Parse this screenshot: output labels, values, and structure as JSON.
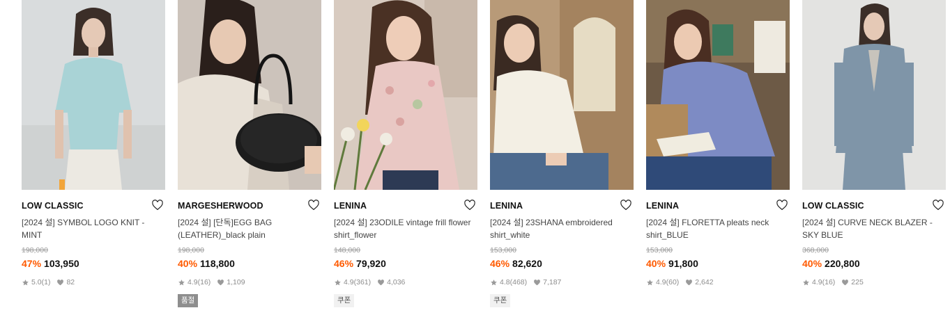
{
  "products": [
    {
      "brand": "LOW CLASSIC",
      "title": "[2024 설] SYMBOL LOGO KNIT - MINT",
      "original_price": "198,000",
      "discount": "47%",
      "price": "103,950",
      "rating": "5.0",
      "reviews": "(1)",
      "likes": "82",
      "tag": ""
    },
    {
      "brand": "MARGESHERWOOD",
      "title": "[2024 설] [단독]EGG BAG (LEATHER)_black plain",
      "original_price": "198,000",
      "discount": "40%",
      "price": "118,800",
      "rating": "4.9",
      "reviews": "(16)",
      "likes": "1,109",
      "tag": "품절"
    },
    {
      "brand": "LENINA",
      "title": "[2024 설] 23ODILE vintage frill flower shirt_flower",
      "original_price": "148,000",
      "discount": "46%",
      "price": "79,920",
      "rating": "4.9",
      "reviews": "(361)",
      "likes": "4,036",
      "tag": "쿠폰"
    },
    {
      "brand": "LENINA",
      "title": "[2024 설] 23SHANA embroidered shirt_white",
      "original_price": "153,000",
      "discount": "46%",
      "price": "82,620",
      "rating": "4.8",
      "reviews": "(468)",
      "likes": "7,187",
      "tag": "쿠폰"
    },
    {
      "brand": "LENINA",
      "title": "[2024 설] FLORETTA pleats neck shirt_BLUE",
      "original_price": "153,000",
      "discount": "40%",
      "price": "91,800",
      "rating": "4.9",
      "reviews": "(60)",
      "likes": "2,642",
      "tag": ""
    },
    {
      "brand": "LOW CLASSIC",
      "title": "[2024 설] CURVE NECK BLAZER - SKY BLUE",
      "original_price": "368,000",
      "discount": "40%",
      "price": "220,800",
      "rating": "4.9",
      "reviews": "(16)",
      "likes": "225",
      "tag": ""
    }
  ],
  "colors": {
    "discount": "#ff5a00",
    "muted": "#8c8c8c"
  },
  "icons": {
    "like": "heart-outline-icon",
    "star": "star-icon",
    "like_count": "heart-filled-icon"
  }
}
